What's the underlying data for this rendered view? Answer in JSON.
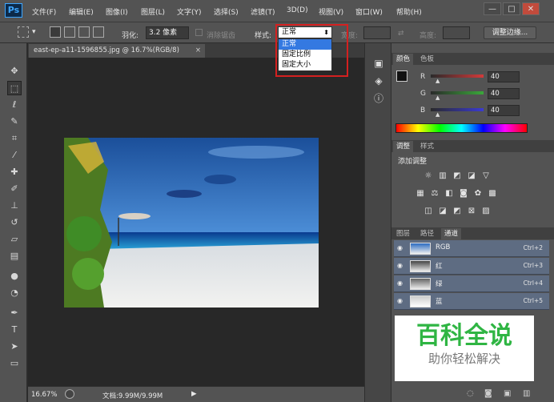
{
  "app": {
    "logo": "Ps"
  },
  "menu": [
    "文件(F)",
    "编辑(E)",
    "图像(I)",
    "图层(L)",
    "文字(Y)",
    "选择(S)",
    "滤镜(T)",
    "3D(D)",
    "视图(V)",
    "窗口(W)",
    "帮助(H)"
  ],
  "window_controls": {
    "minimize": "—",
    "maximize": "□",
    "close": "✕"
  },
  "options": {
    "feather_label": "羽化:",
    "feather_value": "3.2 像素",
    "antialias_label": "消除锯齿",
    "style_label": "样式:",
    "style_selected": "正常",
    "style_options": [
      "正常",
      "固定比例",
      "固定大小"
    ],
    "width_label": "宽度:",
    "height_label": "高度:",
    "refine_edge_button": "调整边缘..."
  },
  "document": {
    "tab_title": "east-ep-a11-1596855.jpg @ 16.7%(RGB/8)",
    "tab_close": "×"
  },
  "status": {
    "zoom": "16.67%",
    "doc_info": "文档:9.99M/9.99M"
  },
  "color_panel": {
    "tabs": [
      "颜色",
      "色板"
    ],
    "channels": [
      {
        "label": "R",
        "value": "40",
        "color": "#d23a3a"
      },
      {
        "label": "G",
        "value": "40",
        "color": "#3aa83a"
      },
      {
        "label": "B",
        "value": "40",
        "color": "#3a3ad2"
      }
    ]
  },
  "adjust_panel": {
    "tabs": [
      "调整",
      "样式"
    ],
    "heading": "添加调整"
  },
  "channels_panel": {
    "tabs": [
      "图层",
      "路径",
      "通道"
    ],
    "rows": [
      {
        "name": "RGB",
        "shortcut": "Ctrl+2"
      },
      {
        "name": "红",
        "shortcut": "Ctrl+3"
      },
      {
        "name": "绿",
        "shortcut": "Ctrl+4"
      },
      {
        "name": "蓝",
        "shortcut": "Ctrl+5"
      }
    ]
  },
  "watermark": {
    "title": "百科全说",
    "subtitle": "助你轻松解决",
    "title_color": "#2fb543"
  }
}
